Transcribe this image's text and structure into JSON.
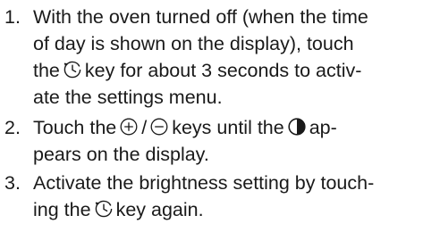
{
  "steps": [
    {
      "number": "1.",
      "lines": [
        [
          "With the oven turned off (when the time"
        ],
        [
          "of day is shown on the display), touch"
        ],
        [
          "the",
          {
            "icon": "clock-icon"
          },
          "key for about 3 seconds to activ-"
        ],
        [
          "ate the settings menu."
        ]
      ]
    },
    {
      "number": "2.",
      "lines": [
        [
          "Touch the",
          {
            "icon": "plus-icon"
          },
          "/",
          {
            "icon": "minus-icon"
          },
          "keys until the",
          {
            "icon": "brightness-icon"
          },
          "ap-"
        ],
        [
          "pears on the display."
        ]
      ]
    },
    {
      "number": "3.",
      "lines": [
        [
          "Activate the brightness setting by touch-"
        ],
        [
          "ing the",
          {
            "icon": "clock-icon"
          },
          "key again."
        ]
      ]
    }
  ]
}
